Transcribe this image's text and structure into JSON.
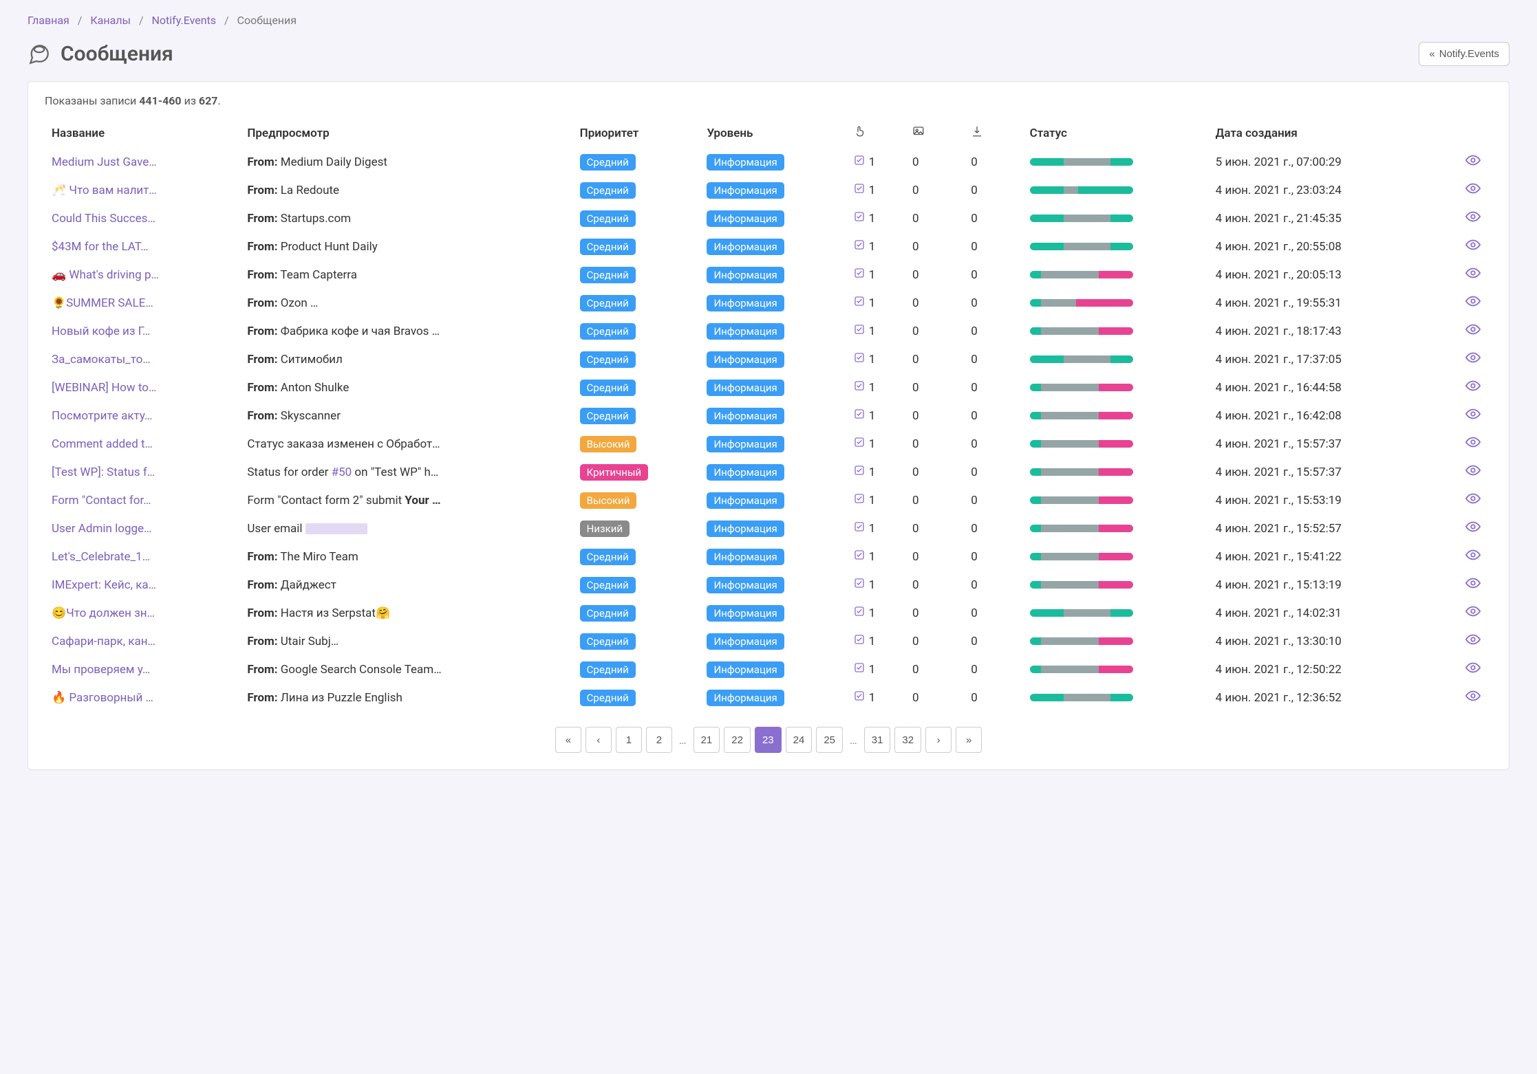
{
  "breadcrumb": {
    "home": "Главная",
    "channels": "Каналы",
    "notify": "Notify.Events",
    "current": "Сообщения"
  },
  "page_title": "Сообщения",
  "back_button": "Notify.Events",
  "summary": {
    "prefix": "Показаны записи",
    "range": "441-460",
    "of": "из",
    "total": "627"
  },
  "columns": {
    "title": "Название",
    "preview": "Предпросмотр",
    "priority": "Приоритет",
    "level": "Уровень",
    "status": "Статус",
    "date": "Дата создания"
  },
  "priority_labels": {
    "medium": "Средний",
    "high": "Высокий",
    "critical": "Критичный",
    "low": "Низкий"
  },
  "level_labels": {
    "info": "Информация"
  },
  "rows": [
    {
      "title": "Medium Just Gave…",
      "from": "Medium Daily Digest <noreply…",
      "priority": "medium",
      "level": "info",
      "c1": 1,
      "c2": 0,
      "c3": 0,
      "segs": [
        33,
        45,
        22,
        "teal"
      ],
      "date": "5 июн. 2021 г., 07:00:29"
    },
    {
      "title": "🥂 Что вам налит…",
      "from": "La Redoute <info@em.laredo…",
      "priority": "medium",
      "level": "info",
      "c1": 1,
      "c2": 0,
      "c3": 0,
      "segs": [
        33,
        14,
        53,
        "teal"
      ],
      "date": "4 июн. 2021 г., 23:03:24"
    },
    {
      "title": "Could This Succes…",
      "from": "Startups.com <wil@startups…",
      "priority": "medium",
      "level": "info",
      "c1": 1,
      "c2": 0,
      "c3": 0,
      "segs": [
        33,
        45,
        22,
        "teal"
      ],
      "date": "4 июн. 2021 г., 21:45:35"
    },
    {
      "title": "$43M for the LAT…",
      "from": "Product Hunt Daily <hello@di…",
      "priority": "medium",
      "level": "info",
      "c1": 1,
      "c2": 0,
      "c3": 0,
      "segs": [
        33,
        45,
        22,
        "teal"
      ],
      "date": "4 июн. 2021 г., 20:55:08"
    },
    {
      "title": "🚗 What's driving p…",
      "from": "Team Capterra <teamcapterr…",
      "priority": "medium",
      "level": "info",
      "c1": 1,
      "c2": 0,
      "c3": 0,
      "segs": [
        11,
        56,
        33,
        "pink"
      ],
      "date": "4 июн. 2021 г., 20:05:13"
    },
    {
      "title": "🌻SUMMER SALE…",
      "from": "Ozon <news@news.ozon.ru> …",
      "priority": "medium",
      "level": "info",
      "c1": 1,
      "c2": 0,
      "c3": 0,
      "segs": [
        11,
        34,
        55,
        "pink"
      ],
      "date": "4 июн. 2021 г., 19:55:31"
    },
    {
      "title": "Новый кофе из Г…",
      "from": "Фабрика кофе и чая Bravos …",
      "priority": "medium",
      "level": "info",
      "c1": 1,
      "c2": 0,
      "c3": 0,
      "segs": [
        11,
        56,
        33,
        "pink"
      ],
      "date": "4 июн. 2021 г., 18:17:43"
    },
    {
      "title": "За_самокаты_то…",
      "from": "Ситимобил <noreply@city-m…",
      "priority": "medium",
      "level": "info",
      "c1": 1,
      "c2": 0,
      "c3": 0,
      "segs": [
        33,
        45,
        22,
        "teal"
      ],
      "date": "4 июн. 2021 г., 17:37:05"
    },
    {
      "title": "[WEBINAR] How to…",
      "from": "Anton Shulke <a.shulke@sem…",
      "priority": "medium",
      "level": "info",
      "c1": 1,
      "c2": 0,
      "c3": 0,
      "segs": [
        11,
        56,
        33,
        "pink"
      ],
      "date": "4 июн. 2021 г., 16:44:58"
    },
    {
      "title": "Посмотрите акту…",
      "from": "Skyscanner <price-alerts@se…",
      "priority": "medium",
      "level": "info",
      "c1": 1,
      "c2": 0,
      "c3": 0,
      "segs": [
        11,
        56,
        33,
        "pink"
      ],
      "date": "4 июн. 2021 г., 16:42:08"
    },
    {
      "title": "Comment added t…",
      "plain": "Статус заказа изменен с Обработ…",
      "priority": "high",
      "level": "info",
      "c1": 1,
      "c2": 0,
      "c3": 0,
      "segs": [
        11,
        56,
        33,
        "pink"
      ],
      "date": "4 июн. 2021 г., 15:57:37"
    },
    {
      "title": "[Test WP]: Status f…",
      "plain_pre": "Status for order ",
      "link": "#50",
      "plain_post": " on \"Test WP\" h…",
      "priority": "critical",
      "level": "info",
      "c1": 1,
      "c2": 0,
      "c3": 0,
      "segs": [
        11,
        56,
        33,
        "pink"
      ],
      "date": "4 июн. 2021 г., 15:57:37"
    },
    {
      "title": "Form \"Contact for…",
      "plain_pre": "Form \"Contact form 2\" submit ",
      "bold": "Your …",
      "priority": "high",
      "level": "info",
      "c1": 1,
      "c2": 0,
      "c3": 0,
      "segs": [
        11,
        56,
        33,
        "pink"
      ],
      "date": "4 июн. 2021 г., 15:53:19"
    },
    {
      "title": "User Admin logge…",
      "plain": "User email",
      "redacted": true,
      "priority": "low",
      "level": "info",
      "c1": 1,
      "c2": 0,
      "c3": 0,
      "segs": [
        11,
        56,
        33,
        "pink"
      ],
      "date": "4 июн. 2021 г., 15:52:57"
    },
    {
      "title": "Let's_Celebrate_1…",
      "from": "The Miro Team <notification…",
      "priority": "medium",
      "level": "info",
      "c1": 1,
      "c2": 0,
      "c3": 0,
      "segs": [
        11,
        56,
        33,
        "pink"
      ],
      "date": "4 июн. 2021 г., 15:41:22"
    },
    {
      "title": "IMExpert: Кейс, ка…",
      "from": "Дайджест <digest@imweek…",
      "priority": "medium",
      "level": "info",
      "c1": 1,
      "c2": 0,
      "c3": 0,
      "segs": [
        11,
        56,
        33,
        "pink"
      ],
      "date": "4 июн. 2021 г., 15:13:19"
    },
    {
      "title": "😊Что должен зн…",
      "from": "Настя из Serpstat🤗 <a.sotul…",
      "priority": "medium",
      "level": "info",
      "c1": 1,
      "c2": 0,
      "c3": 0,
      "segs": [
        33,
        45,
        22,
        "teal"
      ],
      "date": "4 июн. 2021 г., 14:02:31"
    },
    {
      "title": "Сафари-парк, кан…",
      "from": "Utair <news@nl.utair.ru> Subj…",
      "priority": "medium",
      "level": "info",
      "c1": 1,
      "c2": 0,
      "c3": 0,
      "segs": [
        11,
        56,
        33,
        "pink"
      ],
      "date": "4 июн. 2021 г., 13:30:10"
    },
    {
      "title": "Мы проверяем у…",
      "from": "Google Search Console Team…",
      "priority": "medium",
      "level": "info",
      "c1": 1,
      "c2": 0,
      "c3": 0,
      "segs": [
        11,
        56,
        33,
        "pink"
      ],
      "date": "4 июн. 2021 г., 12:50:22"
    },
    {
      "title": "🔥 Разговорный …",
      "from": "Лина из Puzzle English <info…",
      "priority": "medium",
      "level": "info",
      "c1": 1,
      "c2": 0,
      "c3": 0,
      "segs": [
        33,
        45,
        22,
        "teal"
      ],
      "date": "4 июн. 2021 г., 12:36:52"
    }
  ],
  "pagination": {
    "pages_left": [
      "1",
      "2"
    ],
    "pages_mid": [
      "21",
      "22",
      "23",
      "24",
      "25"
    ],
    "pages_right": [
      "31",
      "32"
    ],
    "active": "23"
  }
}
